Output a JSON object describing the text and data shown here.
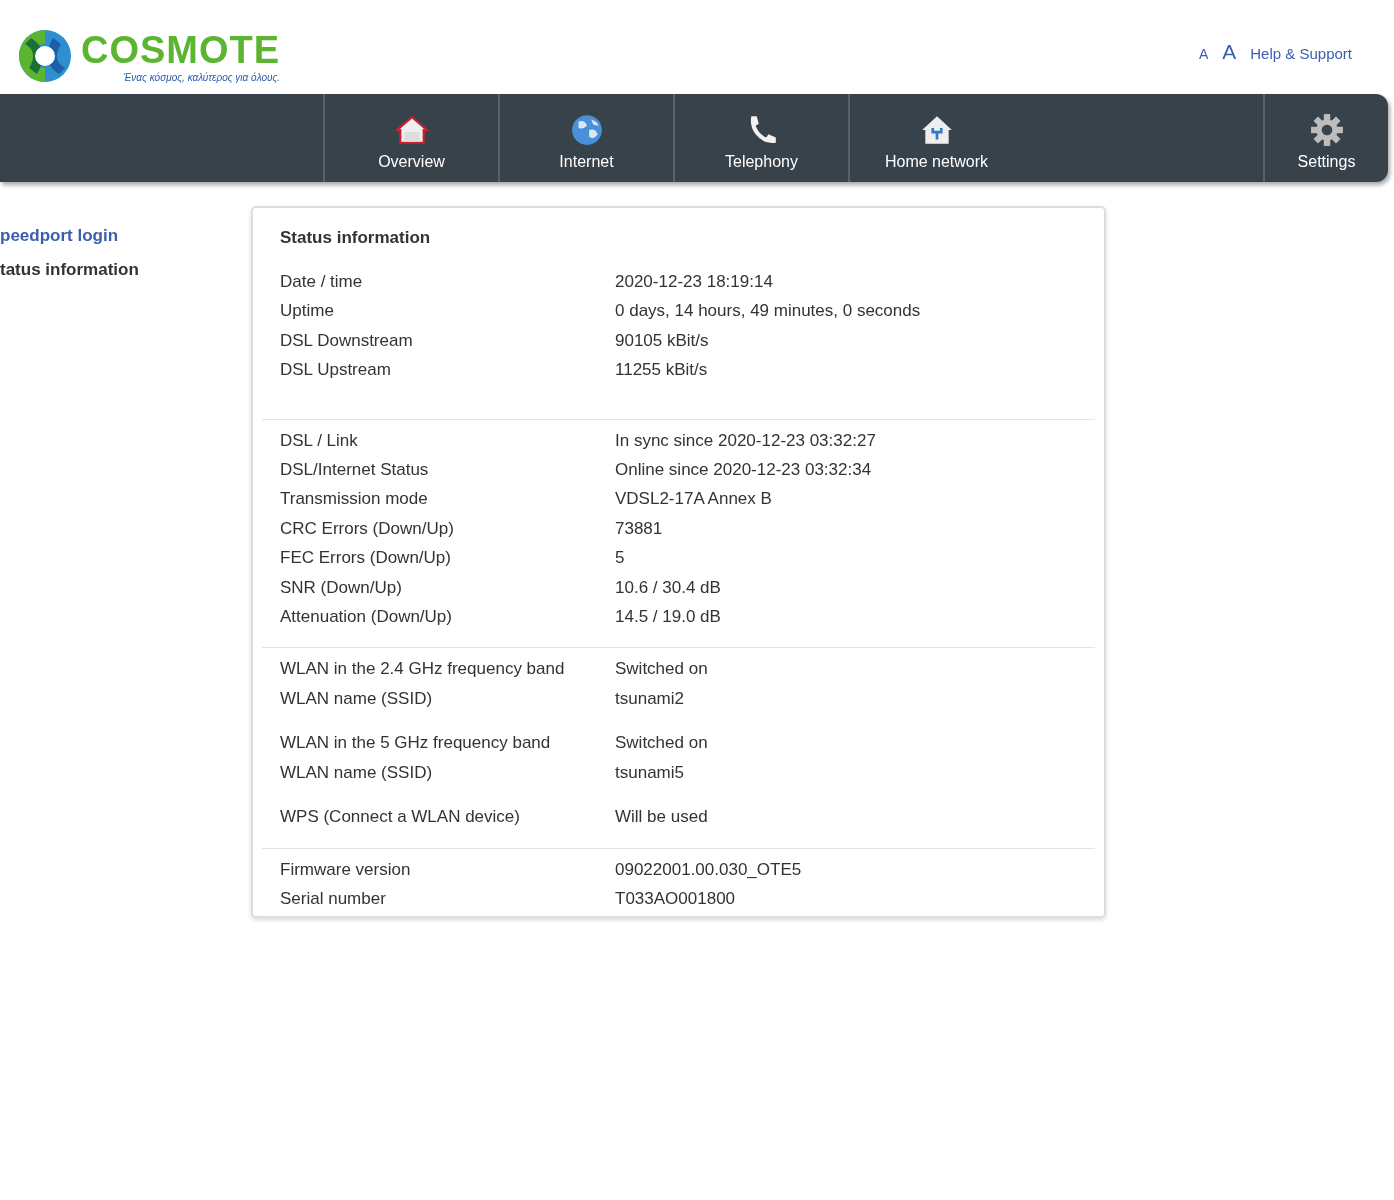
{
  "header": {
    "brand": "COSMOTE",
    "slogan": "Ένας κόσμος, καλύτερος για όλους.",
    "font_small": "A",
    "font_large": "A",
    "help_link": "Help & Support"
  },
  "nav": [
    {
      "label": "Overview"
    },
    {
      "label": "Internet"
    },
    {
      "label": "Telephony"
    },
    {
      "label": "Home network"
    },
    {
      "label": "Settings"
    }
  ],
  "sidebar": {
    "items": [
      {
        "label": "peedport login",
        "selected": false
      },
      {
        "label": "tatus information",
        "selected": true
      }
    ]
  },
  "panel": {
    "title": "Status information",
    "sections": [
      {
        "groups": [
          [
            {
              "label": "Date / time",
              "value": "2020-12-23 18:19:14"
            },
            {
              "label": "Uptime",
              "value": "0 days, 14 hours, 49 minutes, 0 seconds"
            },
            {
              "label": "DSL Downstream",
              "value": "90105 kBit/s"
            },
            {
              "label": "DSL Upstream",
              "value": "11255 kBit/s"
            }
          ]
        ]
      },
      {
        "groups": [
          [
            {
              "label": "DSL / Link",
              "value": "In sync since 2020-12-23 03:32:27"
            },
            {
              "label": "DSL/Internet Status",
              "value": "Online since 2020-12-23 03:32:34"
            },
            {
              "label": "Transmission mode",
              "value": "VDSL2-17A Annex B"
            },
            {
              "label": "CRC Errors (Down/Up)",
              "value": "73881"
            },
            {
              "label": "FEC Errors (Down/Up)",
              "value": "5"
            },
            {
              "label": "SNR (Down/Up)",
              "value": "10.6 / 30.4 dB"
            },
            {
              "label": "Attenuation (Down/Up)",
              "value": "14.5 / 19.0 dB"
            }
          ]
        ]
      },
      {
        "groups": [
          [
            {
              "label": "WLAN in the 2.4 GHz frequency band",
              "value": "Switched on"
            },
            {
              "label": "WLAN name (SSID)",
              "value": "tsunami2"
            }
          ],
          [
            {
              "label": "WLAN in the 5 GHz frequency band",
              "value": "Switched on"
            },
            {
              "label": "WLAN name (SSID)",
              "value": "tsunami5"
            }
          ],
          [
            {
              "label": "WPS (Connect a WLAN device)",
              "value": "Will be used"
            }
          ]
        ]
      },
      {
        "groups": [
          [
            {
              "label": "Firmware version",
              "value": "09022001.00.030_OTE5"
            },
            {
              "label": "Serial number",
              "value": "T033AO001800"
            }
          ]
        ]
      }
    ]
  }
}
